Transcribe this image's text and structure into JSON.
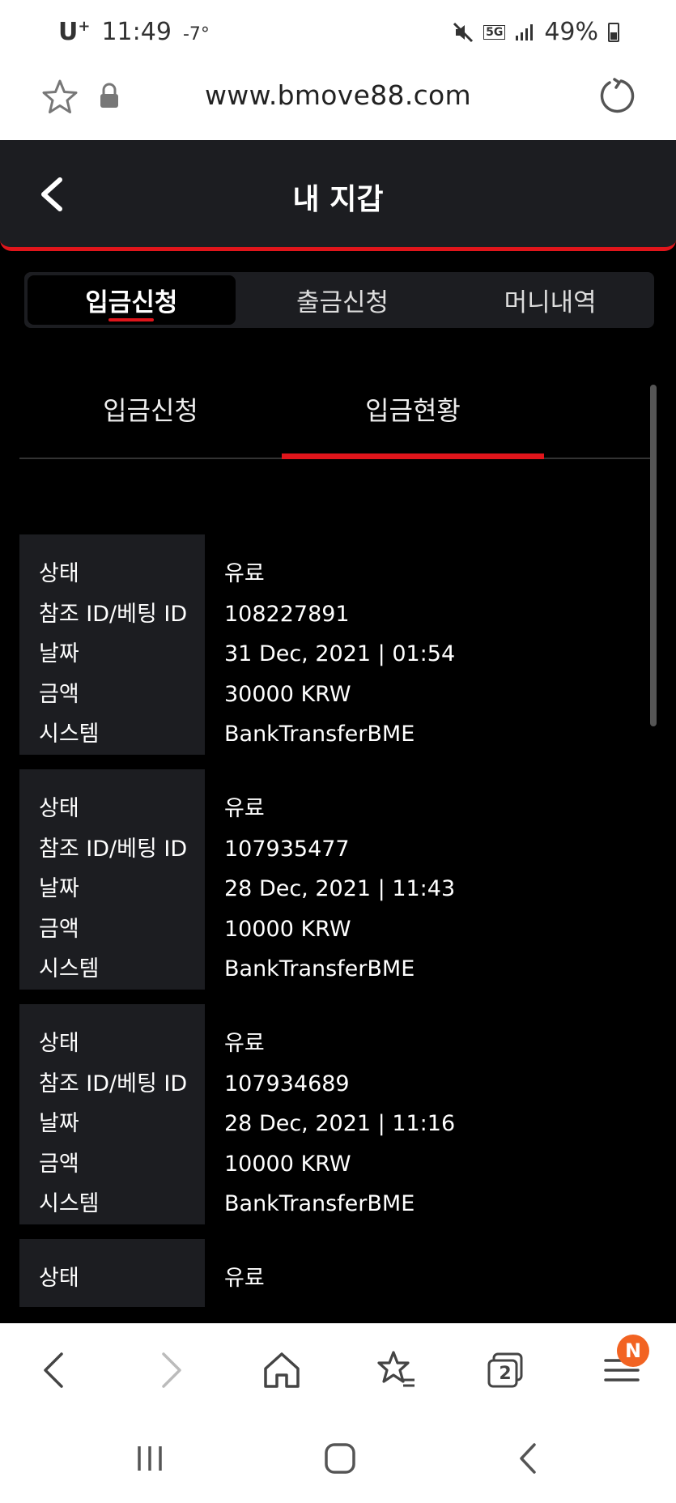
{
  "status_bar": {
    "carrier": "U",
    "carrier_sup": "+",
    "time": "11:49",
    "temperature": "-7°",
    "network": "5G",
    "battery": "49%"
  },
  "url_bar": {
    "url": "www.bmove88.com"
  },
  "header": {
    "title": "내 지갑"
  },
  "main_tabs": [
    {
      "label": "입금신청",
      "active": true
    },
    {
      "label": "출금신청",
      "active": false
    },
    {
      "label": "머니내역",
      "active": false
    }
  ],
  "sub_tabs": [
    {
      "label": "입금신청",
      "active": false
    },
    {
      "label": "입금현황",
      "active": true
    }
  ],
  "field_labels": {
    "status": "상태",
    "ref_id": "참조 ID/베팅 ID",
    "date": "날짜",
    "amount": "금액",
    "system": "시스템"
  },
  "records": [
    {
      "status": "유료",
      "ref_id": "108227891",
      "date": "31 Dec, 2021 | 01:54",
      "amount": "30000 KRW",
      "system": "BankTransferBME"
    },
    {
      "status": "유료",
      "ref_id": "107935477",
      "date": "28 Dec, 2021 | 11:43",
      "amount": "10000 KRW",
      "system": "BankTransferBME"
    },
    {
      "status": "유료",
      "ref_id": "107934689",
      "date": "28 Dec, 2021 | 11:16",
      "amount": "10000 KRW",
      "system": "BankTransferBME"
    },
    {
      "status": "유료"
    }
  ],
  "browser_nav": {
    "tabs_count": "2",
    "menu_badge": "N"
  },
  "colors": {
    "accent": "#e0151b",
    "panel": "#1c1d21",
    "badge": "#f26322"
  }
}
